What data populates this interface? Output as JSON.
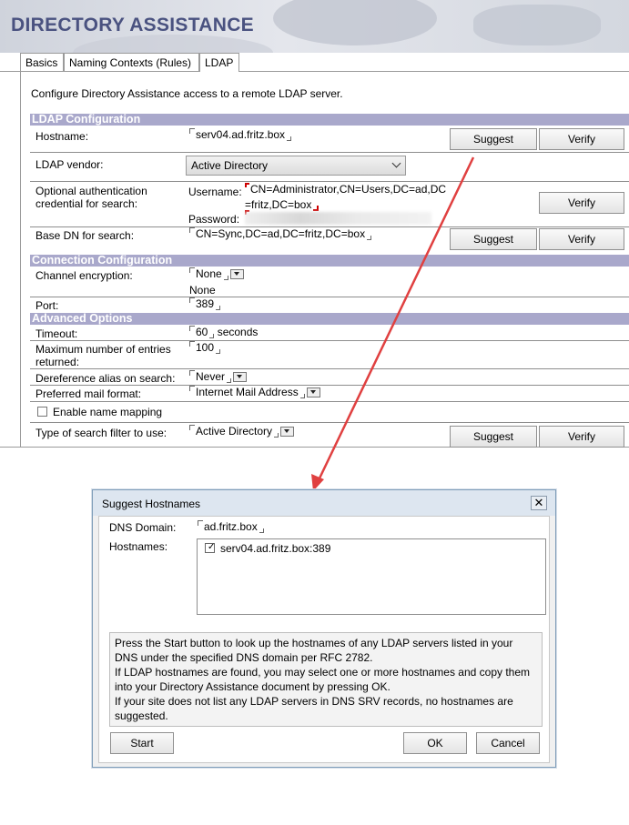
{
  "header": {
    "title": "DIRECTORY ASSISTANCE"
  },
  "tabs": [
    {
      "label": "Basics"
    },
    {
      "label": "Naming Contexts (Rules)"
    },
    {
      "label": "LDAP"
    }
  ],
  "intro": "Configure Directory Assistance access to a remote LDAP server.",
  "ldap_config": {
    "section_title": "LDAP Configuration",
    "hostname_label": "Hostname:",
    "hostname_value": "serv04.ad.fritz.box",
    "vendor_label": "LDAP vendor:",
    "vendor_value": "Active Directory",
    "auth_label_1": "Optional authentication",
    "auth_label_2": "credential for search:",
    "username_label": "Username:",
    "username_line1": "CN=Administrator,CN=Users,DC=ad,DC",
    "username_line2": "=fritz,DC=box",
    "password_label": "Password:",
    "basedn_label": "Base DN for search:",
    "basedn_value": "CN=Sync,DC=ad,DC=fritz,DC=box"
  },
  "connection_config": {
    "section_title": "Connection Configuration",
    "channel_label": "Channel encryption:",
    "channel_value": "None",
    "channel_value_display": "None",
    "port_label": "Port:",
    "port_value": "389"
  },
  "advanced": {
    "section_title": "Advanced Options",
    "timeout_label": "Timeout:",
    "timeout_value": "60",
    "timeout_unit": "seconds",
    "maxentries_label_1": "Maximum number of entries",
    "maxentries_label_2": "returned:",
    "maxentries_value": "100",
    "deref_label": "Dereference alias on search:",
    "deref_value": "Never",
    "mailformat_label": "Preferred mail format:",
    "mailformat_value": "Internet Mail Address",
    "name_mapping_label": "Enable name mapping",
    "name_mapping_checked": false,
    "filter_label": "Type of search filter to use:",
    "filter_value": "Active Directory"
  },
  "buttons": {
    "suggest": "Suggest",
    "verify": "Verify"
  },
  "dialog": {
    "title": "Suggest Hostnames",
    "dns_label": "DNS Domain:",
    "dns_value": "ad.fritz.box",
    "hostnames_label": "Hostnames:",
    "hostnames": [
      {
        "label": "serv04.ad.fritz.box:389",
        "checked": true
      }
    ],
    "info_lines": [
      "Press the Start button to look up the hostnames of any LDAP servers listed in your",
      "DNS under the specified DNS domain per RFC 2782.",
      "If LDAP hostnames are found, you may select one or more hostnames and copy them",
      "into your Directory Assistance document by pressing OK.",
      "If your site does not list any LDAP servers in DNS SRV records, no hostnames are",
      "suggested."
    ],
    "start_label": "Start",
    "ok_label": "OK",
    "cancel_label": "Cancel"
  },
  "colors": {
    "section_bar": "#a9a8cb",
    "title": "#4a5280",
    "arrow": "#e04040"
  }
}
